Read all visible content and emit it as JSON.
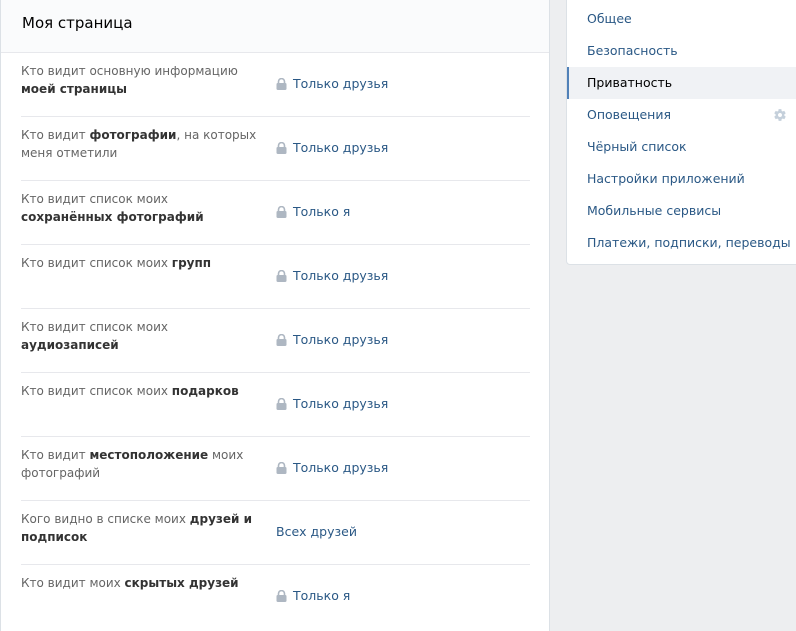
{
  "main": {
    "title": "Моя страница",
    "rows": [
      {
        "label_pre": "Кто видит основную информацию ",
        "label_bold": "моей страницы",
        "label_post": "",
        "value": "Только друзья",
        "locked": true
      },
      {
        "label_pre": "Кто видит ",
        "label_bold": "фотографии",
        "label_post": ", на которых меня отметили",
        "value": "Только друзья",
        "locked": true
      },
      {
        "label_pre": "Кто видит список моих ",
        "label_bold": "сохранённых фотографий",
        "label_post": "",
        "value": "Только я",
        "locked": true
      },
      {
        "label_pre": "Кто видит список моих ",
        "label_bold": "групп",
        "label_post": "",
        "value": "Только друзья",
        "locked": true
      },
      {
        "label_pre": "Кто видит список моих ",
        "label_bold": "аудиозаписей",
        "label_post": "",
        "value": "Только друзья",
        "locked": true
      },
      {
        "label_pre": "Кто видит список моих ",
        "label_bold": "подарков",
        "label_post": "",
        "value": "Только друзья",
        "locked": true
      },
      {
        "label_pre": "Кто видит ",
        "label_bold": "местоположение",
        "label_post": " моих фотографий",
        "value": "Только друзья",
        "locked": true
      },
      {
        "label_pre": "Кого видно в списке моих ",
        "label_bold": "друзей и подписок",
        "label_post": "",
        "value": "Всех друзей",
        "locked": false
      },
      {
        "label_pre": "Кто видит моих ",
        "label_bold": "скрытых друзей",
        "label_post": "",
        "value": "Только я",
        "locked": true
      }
    ]
  },
  "sidebar": {
    "items": [
      {
        "label": "Общее"
      },
      {
        "label": "Безопасность"
      },
      {
        "label": "Приватность"
      },
      {
        "label": "Оповещения"
      },
      {
        "label": "Чёрный список"
      },
      {
        "label": "Настройки приложений"
      },
      {
        "label": "Мобильные сервисы"
      },
      {
        "label": "Платежи, подписки, переводы"
      }
    ],
    "active_index": 2
  },
  "colors": {
    "link": "#2a5885",
    "accent": "#5181b8",
    "icon_gray": "#aeb7c2",
    "background": "#edeef0"
  },
  "icons": {
    "lock": "lock-icon",
    "settings": "gear-icon"
  }
}
